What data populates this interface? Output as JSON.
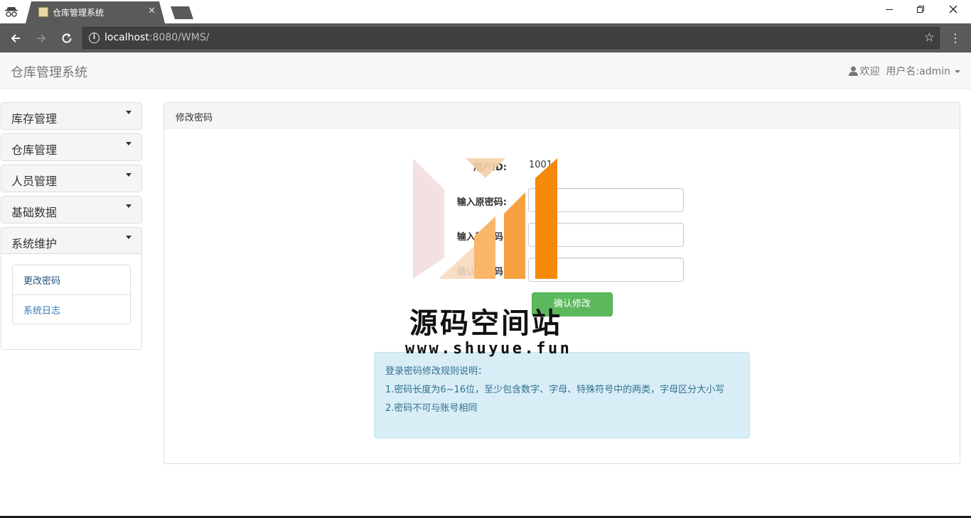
{
  "browser": {
    "tab_title": "仓库管理系统",
    "tab_close": "✕",
    "url_host": "localhost",
    "url_rest": ":8080/WMS/"
  },
  "navbar": {
    "brand": "仓库管理系统",
    "welcome": "欢迎",
    "username": "用户名:admin"
  },
  "sidebar": {
    "sections": [
      {
        "label": "库存管理"
      },
      {
        "label": "仓库管理"
      },
      {
        "label": "人员管理"
      },
      {
        "label": "基础数据"
      },
      {
        "label": "系统维护"
      }
    ],
    "submenu": [
      {
        "label": "更改密码"
      },
      {
        "label": "系统日志"
      }
    ]
  },
  "main": {
    "panel_title": "修改密码",
    "user_id_label": "用户ID:",
    "user_id_value": "1001",
    "old_password_label": "输入原密码:",
    "new_password_label": "输入新密码:",
    "confirm_password_label": "确认新密码:",
    "confirm_button": "确认修改",
    "rules": {
      "title": "登录密码修改规则说明：",
      "rule1": "1.密码长度为6~16位，至少包含数字、字母、特殊符号中的两类，字母区分大小写",
      "rule2": "2.密码不可与账号相同"
    }
  },
  "watermark": {
    "text": "源码空间站",
    "url": "www.shuyue.fun"
  },
  "colors": {
    "chrome_dark": "#5a5a5a",
    "success_green": "#5cb85c",
    "info_bg": "#d9edf7",
    "info_text": "#31708f",
    "link_blue": "#337ab7",
    "watermark_orange": "#f5890a"
  }
}
